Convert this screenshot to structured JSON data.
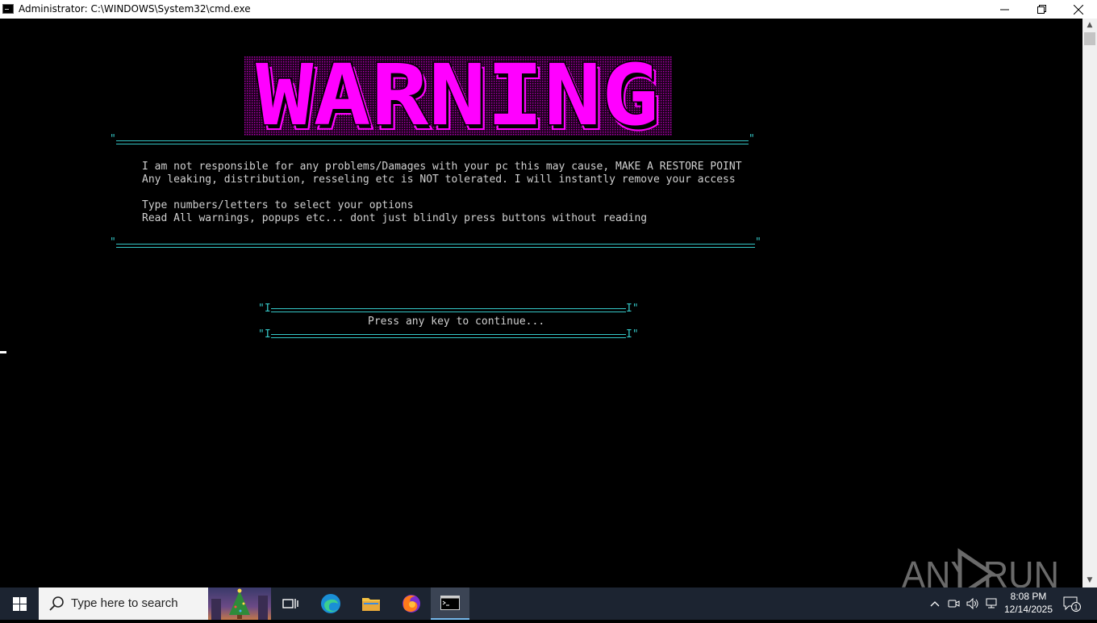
{
  "window": {
    "title": "Administrator: C:\\WINDOWS\\System32\\cmd.exe",
    "minimize": "—",
    "maximize": "❐",
    "close": "✕"
  },
  "console": {
    "banner_text": "WARNING",
    "banner_color": "#ff00ff",
    "rule_color": "#35c6c6",
    "quote": "\"",
    "lines": [
      "I am not responsible for any problems/Damages with your pc this may cause, MAKE A RESTORE POINT",
      "Any leaking, distribution, resseling etc is NOT tolerated. I will instantly remove your access",
      "Type numbers/letters to select your options",
      "Read All warnings, popups etc... dont just blindly press buttons without reading"
    ],
    "box_end_left": "\"I",
    "box_end_right": "I\"",
    "prompt": "Press any key to continue..."
  },
  "watermark": {
    "text": "ANY RUN"
  },
  "taskbar": {
    "search_placeholder": "Type here to search",
    "time": "8:08 PM",
    "date": "12/14/2025",
    "notification_count": "1"
  }
}
